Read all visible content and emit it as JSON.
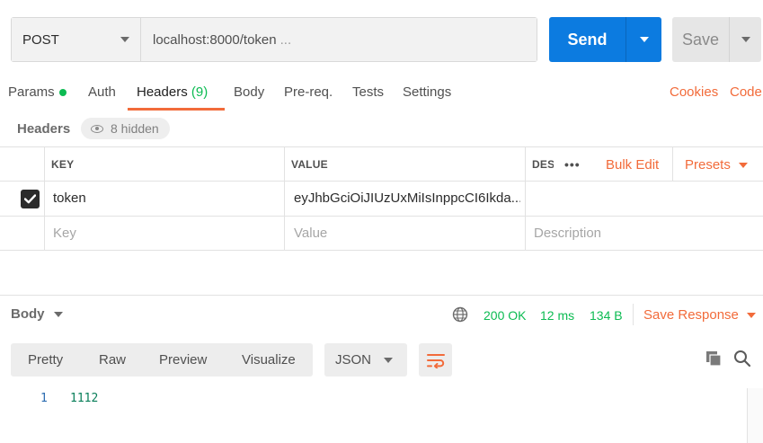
{
  "request": {
    "method": "POST",
    "url": "localhost:8000/token",
    "url_ellipsis": "...",
    "send_label": "Send",
    "save_label": "Save"
  },
  "tabs": {
    "params": "Params",
    "auth": "Auth",
    "headers": "Headers",
    "headers_count": "(9)",
    "body": "Body",
    "prereq": "Pre-req.",
    "tests": "Tests",
    "settings": "Settings",
    "cookies": "Cookies",
    "code": "Code"
  },
  "headers_section": {
    "title": "Headers",
    "hidden_label": "8 hidden"
  },
  "table": {
    "col_key": "KEY",
    "col_value": "VALUE",
    "col_desc": "DES",
    "more": "•••",
    "bulk_edit": "Bulk Edit",
    "presets": "Presets",
    "rows": [
      {
        "checked": true,
        "key": "token",
        "value": "eyJhbGciOiJIUzUxMiIsInppcCI6Ikda..."
      }
    ],
    "placeholder": {
      "key": "Key",
      "value": "Value",
      "description": "Description"
    }
  },
  "response": {
    "body_label": "Body",
    "status": "200 OK",
    "time": "12 ms",
    "size": "134 B",
    "save_response": "Save Response",
    "view_tabs": [
      "Pretty",
      "Raw",
      "Preview",
      "Visualize"
    ],
    "format": "JSON",
    "lines": [
      {
        "no": "1",
        "text": "1112"
      }
    ]
  },
  "colors": {
    "accent": "#f26b3a",
    "primary": "#0c7be0",
    "success": "#0cbb52"
  }
}
